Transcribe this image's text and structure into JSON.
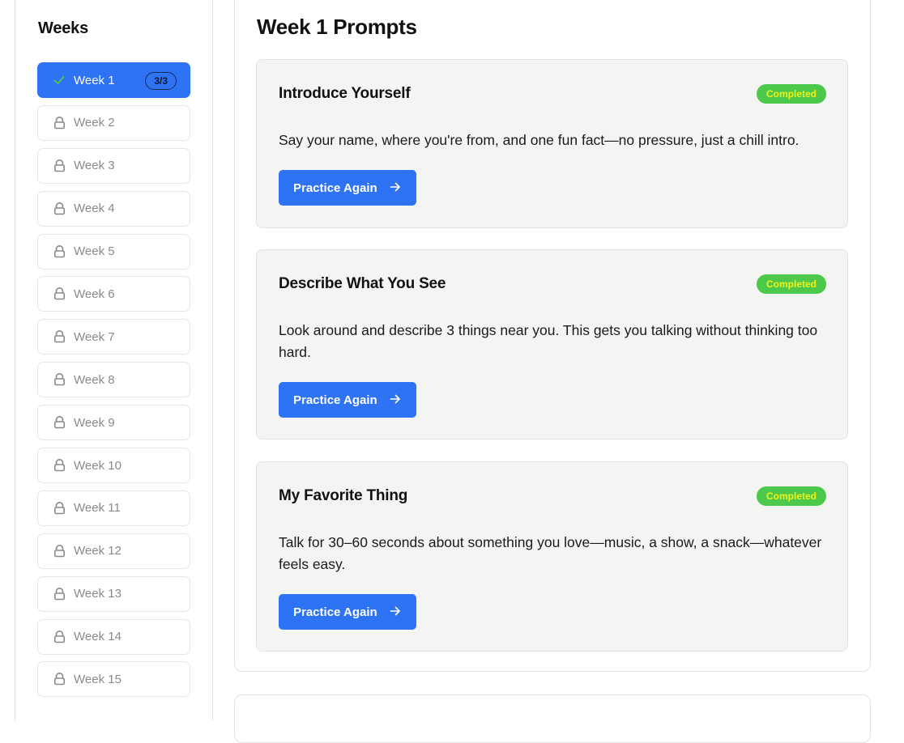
{
  "sidebar": {
    "title": "Weeks",
    "weeks": [
      {
        "label": "Week 1",
        "status": "completed",
        "badge": "3/3"
      },
      {
        "label": "Week 2",
        "status": "locked"
      },
      {
        "label": "Week 3",
        "status": "locked"
      },
      {
        "label": "Week 4",
        "status": "locked"
      },
      {
        "label": "Week 5",
        "status": "locked"
      },
      {
        "label": "Week 6",
        "status": "locked"
      },
      {
        "label": "Week 7",
        "status": "locked"
      },
      {
        "label": "Week 8",
        "status": "locked"
      },
      {
        "label": "Week 9",
        "status": "locked"
      },
      {
        "label": "Week 10",
        "status": "locked"
      },
      {
        "label": "Week 11",
        "status": "locked"
      },
      {
        "label": "Week 12",
        "status": "locked"
      },
      {
        "label": "Week 13",
        "status": "locked"
      },
      {
        "label": "Week 14",
        "status": "locked"
      },
      {
        "label": "Week 15",
        "status": "locked"
      }
    ]
  },
  "main": {
    "title": "Week 1 Prompts",
    "prompts": [
      {
        "title": "Introduce Yourself",
        "status": "Completed",
        "description": "Say your name, where you're from, and one fun fact—no pressure, just a chill intro.",
        "button_label": "Practice Again"
      },
      {
        "title": "Describe What You See",
        "status": "Completed",
        "description": "Look around and describe 3 things near you. This gets you talking without thinking too hard.",
        "button_label": "Practice Again"
      },
      {
        "title": "My Favorite Thing",
        "status": "Completed",
        "description": "Talk for 30–60 seconds about something you love—music, a show, a snack—whatever feels easy.",
        "button_label": "Practice Again"
      }
    ]
  },
  "icons": {
    "completed": "check-icon",
    "locked": "lock-icon",
    "button": "arrow-right-icon"
  },
  "colors": {
    "accent": "#2f73f5",
    "completed_badge_bg": "#4cc94a",
    "completed_badge_text": "#f2f21a",
    "check": "#4cc94a",
    "card_bg": "#f4f4f2"
  }
}
